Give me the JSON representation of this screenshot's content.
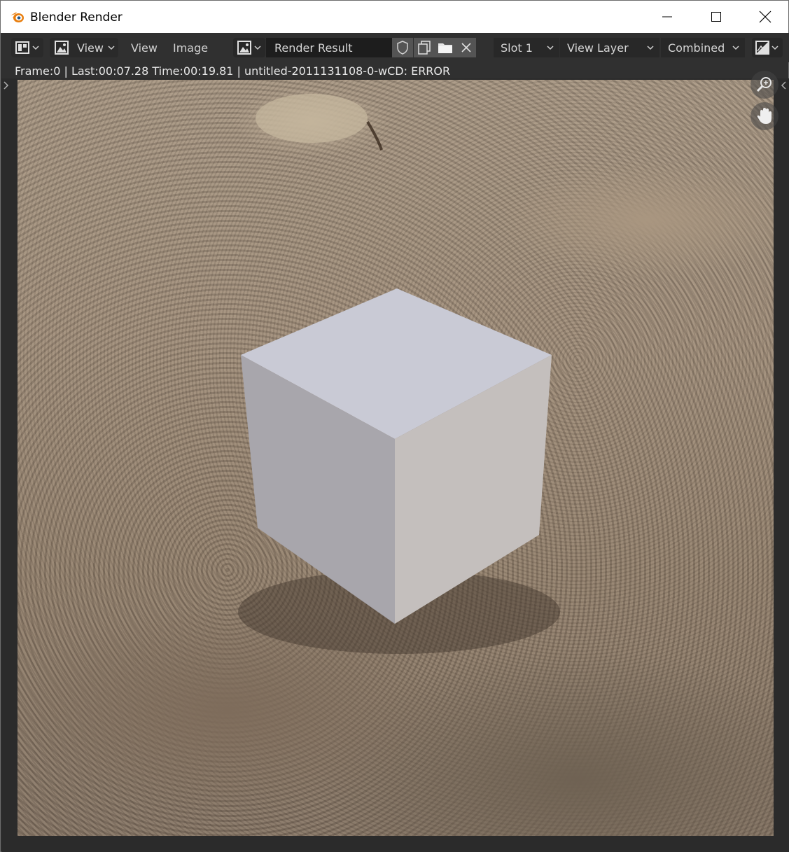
{
  "window": {
    "title": "Blender Render",
    "controls": {
      "minimize": "minimize",
      "maximize": "maximize",
      "close": "close"
    }
  },
  "header": {
    "editor_type_icon": "image-editor-icon",
    "mode": {
      "label": "View",
      "icon": "image-icon"
    },
    "menus": [
      "View",
      "Image"
    ],
    "image_browse_icon": "image-browse-icon",
    "image_name": "Render Result",
    "icons": [
      "fake-user-shield-icon",
      "new-image-icon",
      "open-image-icon",
      "unlink-x-icon"
    ],
    "slot": "Slot 1",
    "view_layer": "View Layer",
    "pass": "Combined",
    "display_channels_icon": "display-channels-icon"
  },
  "status": {
    "text": "Frame:0 | Last:00:07.28 Time:00:19.81 | untitled-2011131108-0-wCD: ERROR"
  },
  "viewport": {
    "zoom_icon": "zoom-icon",
    "pan_icon": "hand-pan-icon"
  }
}
